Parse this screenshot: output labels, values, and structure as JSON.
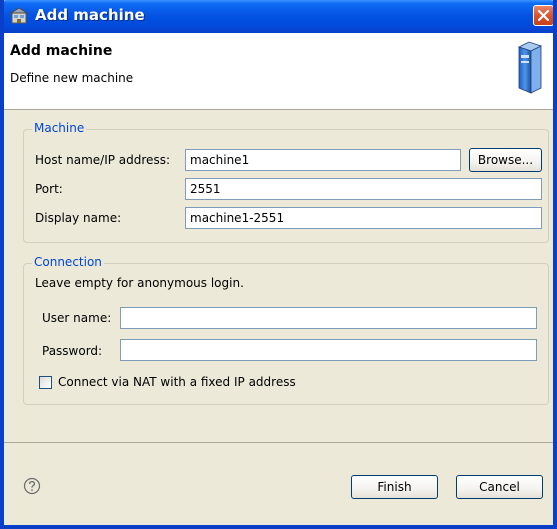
{
  "window": {
    "title": "Add machine"
  },
  "header": {
    "title": "Add machine",
    "subtitle": "Define new machine",
    "icon": "server-icon"
  },
  "machine_group": {
    "legend": "Machine",
    "host_label": "Host name/IP address:",
    "host_value": "machine1",
    "browse_label": "Browse...",
    "port_label": "Port:",
    "port_value": "2551",
    "display_label": "Display name:",
    "display_value": "machine1-2551"
  },
  "connection_group": {
    "legend": "Connection",
    "hint": "Leave empty for anonymous login.",
    "user_label": "User name:",
    "user_value": "",
    "password_label": "Password:",
    "password_value": "",
    "nat_label": "Connect via NAT with a fixed IP address",
    "nat_checked": false
  },
  "footer": {
    "help_icon": "help-icon",
    "finish_label": "Finish",
    "cancel_label": "Cancel"
  },
  "colors": {
    "titlebar": "#0554e3",
    "legend_text": "#0046d5",
    "dialog_bg": "#ece9d8",
    "close_button": "#d8532c"
  }
}
